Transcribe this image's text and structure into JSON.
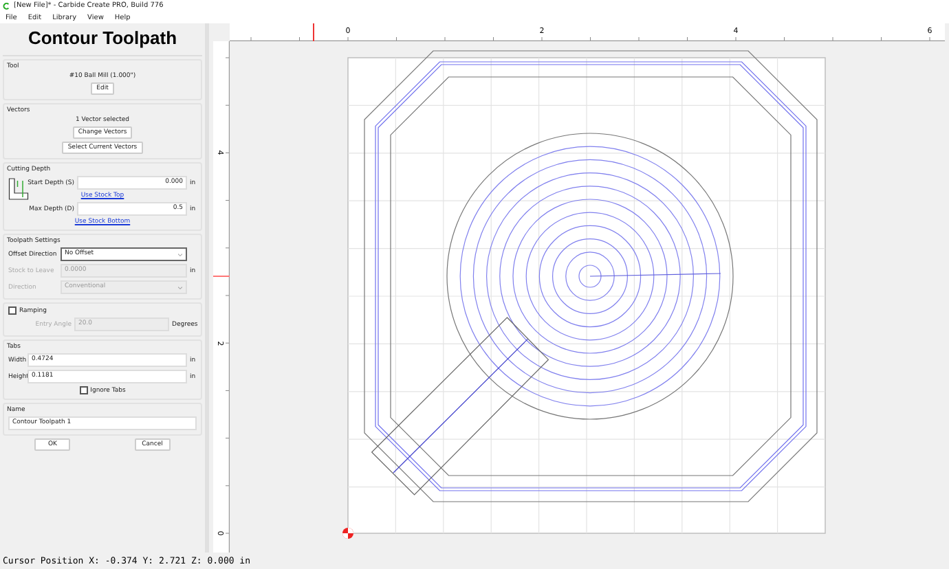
{
  "window": {
    "title": "[New File]* - Carbide Create PRO, Build 776"
  },
  "menu": [
    "File",
    "Edit",
    "Library",
    "View",
    "Help"
  ],
  "panel": {
    "title": "Contour Toolpath",
    "tool": {
      "heading": "Tool",
      "name": "#10 Ball Mill (1.000\")",
      "button": "Edit"
    },
    "vectors": {
      "heading": "Vectors",
      "count": "1 Vector selected",
      "buttons": [
        "Change Vectors",
        "Select Current Vectors"
      ]
    },
    "cutting_depth": {
      "heading": "Cutting Depth",
      "start_label": "Start Depth (S)",
      "start_value": "0.000",
      "start_unit": "in",
      "start_link": "Use Stock Top",
      "max_label": "Max Depth (D)",
      "max_value": "0.5",
      "max_unit": "in",
      "max_link": "Use Stock Bottom"
    },
    "toolpath_settings": {
      "heading": "Toolpath Settings",
      "offset_label": "Offset Direction",
      "offset_value": "No Offset",
      "stock_label": "Stock to Leave",
      "stock_value": "0.0000",
      "stock_unit": "in",
      "stock_disabled": true,
      "direction_label": "Direction",
      "direction_value": "Conventional",
      "direction_disabled": true
    },
    "ramping": {
      "label": "Ramping",
      "checked": false,
      "angle_label": "Entry Angle",
      "angle_value": "20.0",
      "angle_unit": "Degrees",
      "disabled": true
    },
    "tabs": {
      "heading": "Tabs",
      "width_label": "Width",
      "width_value": "0.4724",
      "width_unit": "in",
      "height_label": "Height",
      "height_value": "0.1181",
      "height_unit": "in",
      "ignore_label": "Ignore Tabs",
      "ignore_checked": false
    },
    "name": {
      "heading": "Name",
      "value": "Contour Toolpath 1"
    },
    "buttons": [
      "OK",
      "Cancel"
    ]
  },
  "rulers": {
    "top_labels": [
      "0",
      "2",
      "4",
      "6"
    ],
    "left_labels": [
      "4",
      "2",
      "0"
    ]
  },
  "status_bar": {
    "cursor": "Cursor Position X: -0.374 Y: 2.721 Z: 0.000 in"
  }
}
